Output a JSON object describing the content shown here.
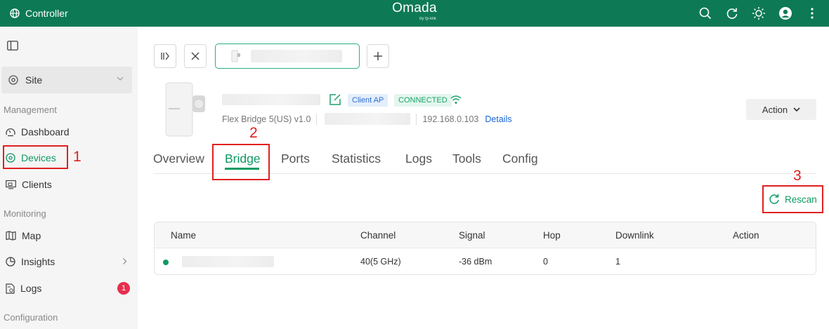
{
  "topbar": {
    "app_title": "Controller",
    "brand_name": "Omada",
    "brand_sub": "by tp-link"
  },
  "sidebar": {
    "site_label": "Site",
    "groups": {
      "management": "Management",
      "monitoring": "Monitoring",
      "configuration": "Configuration"
    },
    "items": {
      "dashboard": "Dashboard",
      "devices": "Devices",
      "clients": "Clients",
      "map": "Map",
      "insights": "Insights",
      "logs": "Logs"
    },
    "logs_badge": "1"
  },
  "device": {
    "tag_mode": "Client AP",
    "tag_status": "CONNECTED",
    "model": "Flex Bridge 5(US) v1.0",
    "ip": "192.168.0.103",
    "details_link": "Details",
    "action_label": "Action"
  },
  "tabs": [
    "Overview",
    "Bridge",
    "Ports",
    "Statistics",
    "Logs",
    "Tools",
    "Config"
  ],
  "rescan_label": "Rescan",
  "table": {
    "headers": [
      "Name",
      "Channel",
      "Signal",
      "Hop",
      "Downlink",
      "Action"
    ],
    "rows": [
      {
        "channel": "40(5 GHz)",
        "signal": "-36 dBm",
        "hop": "0",
        "downlink": "1"
      }
    ]
  },
  "annotations": {
    "n1": "1",
    "n2": "2",
    "n3": "3"
  },
  "colors": {
    "brand_green": "#0d7a55",
    "accent_green": "#0d9a63",
    "annotation_red": "#e02020",
    "link_blue": "#1764d6"
  }
}
